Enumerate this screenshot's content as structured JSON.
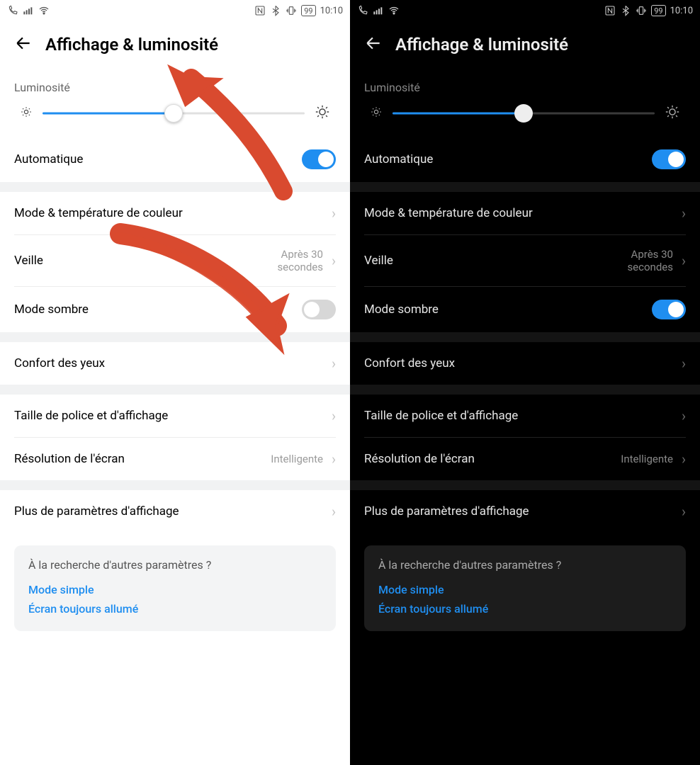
{
  "status": {
    "battery": "99",
    "time": "10:10"
  },
  "page_title": "Affichage & luminosité",
  "brightness": {
    "label": "Luminosité",
    "percent": 50
  },
  "auto_brightness": {
    "label": "Automatique",
    "on": true
  },
  "rows": {
    "color_mode": {
      "label": "Mode & température de couleur"
    },
    "sleep": {
      "label": "Veille",
      "value": "Après 30 secondes"
    },
    "dark_mode": {
      "label": "Mode sombre"
    },
    "eye_comfort": {
      "label": "Confort des yeux"
    },
    "font_size": {
      "label": "Taille de police et d'affichage"
    },
    "resolution": {
      "label": "Résolution de l'écran",
      "value": "Intelligente"
    },
    "more": {
      "label": "Plus de paramètres d'affichage"
    }
  },
  "footer_card": {
    "title": "À la recherche d'autres paramètres ?",
    "link1": "Mode simple",
    "link2": "Écran toujours allumé"
  },
  "panels": {
    "light": {
      "dark_mode_on": false
    },
    "dark": {
      "dark_mode_on": true
    }
  },
  "annotation": {
    "color": "#d94a2f"
  }
}
